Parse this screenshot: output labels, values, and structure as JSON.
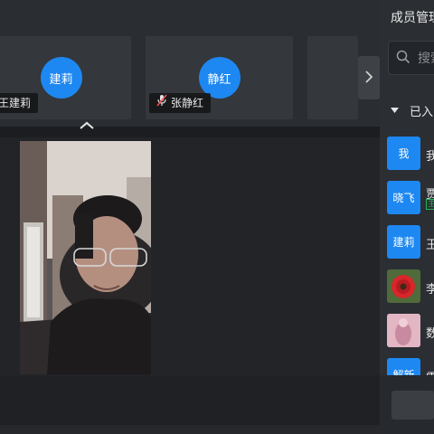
{
  "gallery": {
    "participants": [
      {
        "avatar_text": "建莉",
        "name": "王建莉",
        "mic": "on"
      },
      {
        "avatar_text": "静红",
        "name": "张静红",
        "mic": "muted"
      }
    ],
    "next_icon": "chevron-right-icon",
    "collapse_icon": "chevron-up-icon"
  },
  "panel": {
    "title": "成员管理",
    "search_placeholder": "搜索",
    "group_label": "已入",
    "members": [
      {
        "avatar_text": "我",
        "name": "我",
        "tag": ""
      },
      {
        "avatar_text": "晓飞",
        "name": "贾",
        "tag": "主"
      },
      {
        "avatar_text": "建莉",
        "name": "王",
        "tag": ""
      },
      {
        "avatar_text": "",
        "name": "李",
        "tag": "",
        "avatar_kind": "flower-photo"
      },
      {
        "avatar_text": "",
        "name": "数",
        "tag": "",
        "avatar_kind": "pink-photo"
      },
      {
        "avatar_text": "解新",
        "name": "雷",
        "tag": ""
      }
    ]
  },
  "colors": {
    "accent": "#1e88f2",
    "host_tag": "#23b55b",
    "background": "#1b1d20"
  }
}
